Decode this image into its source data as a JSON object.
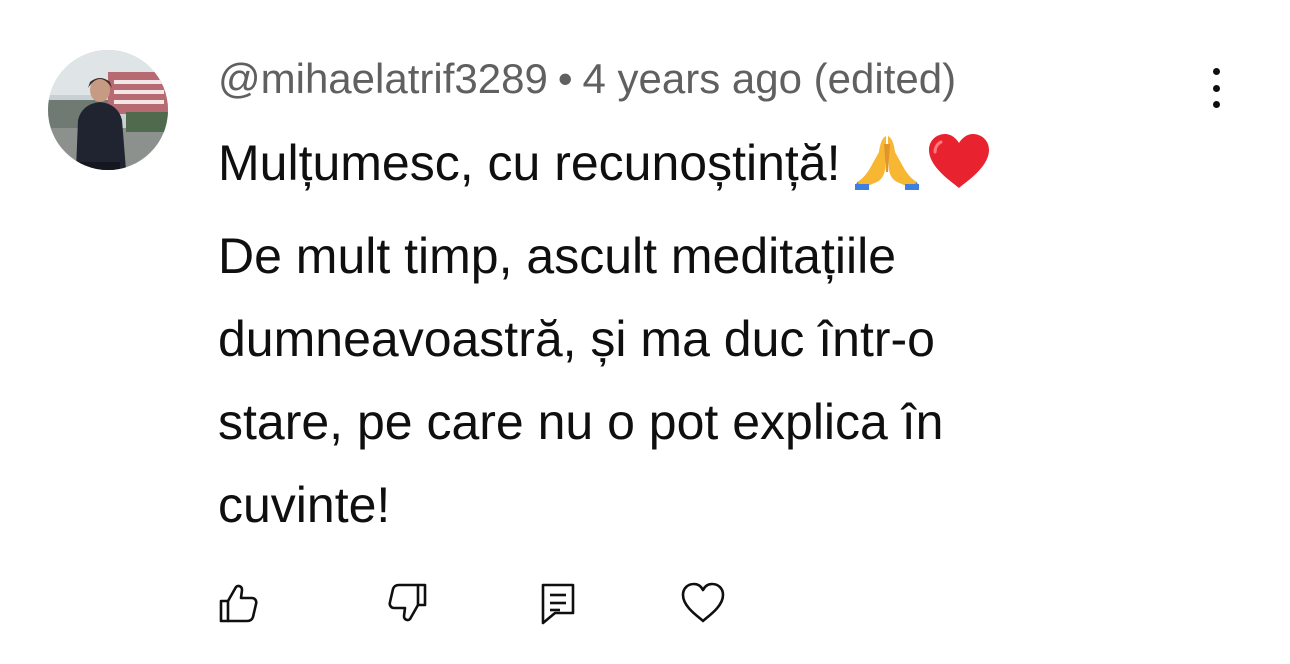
{
  "comment": {
    "author": "@mihaelatrif3289",
    "separator": "•",
    "timestamp": "4 years ago (edited)",
    "lines": [
      "Mulțumesc, cu recunoștință!",
      "De mult timp, ascult meditațiile",
      "dumneavoastră, și ma duc într-o",
      "stare, pe care nu o pot explica în",
      "cuvinte!"
    ],
    "emojis": [
      "folded-hands-emoji",
      "red-heart-emoji"
    ]
  },
  "icons": {
    "more": "more-vertical-icon",
    "like": "thumbs-up-icon",
    "dislike": "thumbs-down-icon",
    "reply": "reply-comment-icon",
    "heart": "heart-icon"
  }
}
